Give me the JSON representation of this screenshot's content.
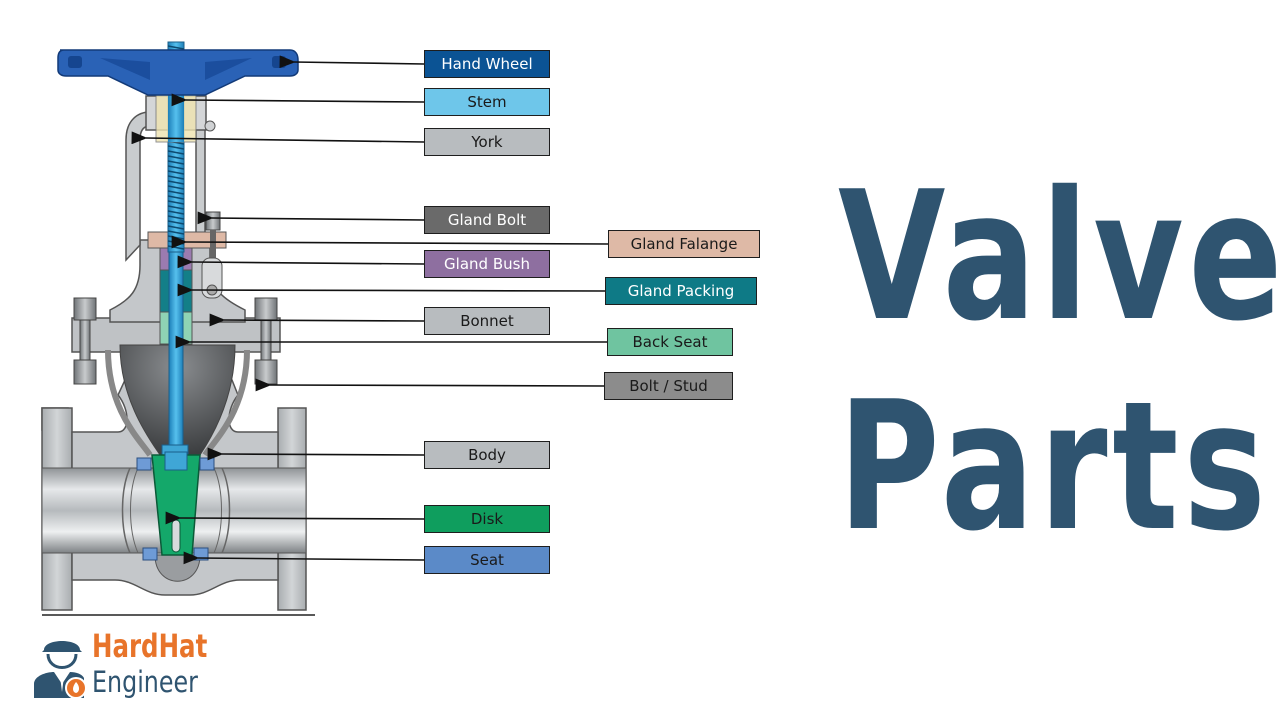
{
  "title": {
    "line1": "Valve",
    "line2": "Parts"
  },
  "logo": {
    "line1": "HardHat",
    "line2": "Engineer",
    "colors": {
      "primary": "#e8742a",
      "secondary": "#2f5470"
    }
  },
  "colors": {
    "title": "#2f5470",
    "label_border": "#1e1e1e"
  },
  "labels": [
    {
      "id": "hand-wheel",
      "text": "Hand Wheel",
      "bg": "#0b5394",
      "fg": "#ffffff"
    },
    {
      "id": "stem",
      "text": "Stem",
      "bg": "#6ec6ea",
      "fg": "#1a1a1a"
    },
    {
      "id": "york",
      "text": "York",
      "bg": "#b8bcbf",
      "fg": "#1a1a1a"
    },
    {
      "id": "gland-bolt",
      "text": "Gland Bolt",
      "bg": "#6a6a6a",
      "fg": "#ffffff"
    },
    {
      "id": "gland-falange",
      "text": "Gland Falange",
      "bg": "#deb9a6",
      "fg": "#1a1a1a"
    },
    {
      "id": "gland-bush",
      "text": "Gland Bush",
      "bg": "#8e6fa0",
      "fg": "#ffffff"
    },
    {
      "id": "gland-packing",
      "text": "Gland Packing",
      "bg": "#0e7a86",
      "fg": "#ffffff"
    },
    {
      "id": "bonnet",
      "text": "Bonnet",
      "bg": "#b8bcbf",
      "fg": "#1a1a1a"
    },
    {
      "id": "back-seat",
      "text": "Back Seat",
      "bg": "#6fc4a0",
      "fg": "#1a1a1a"
    },
    {
      "id": "bolt-stud",
      "text": "Bolt / Stud",
      "bg": "#8c8c8c",
      "fg": "#1a1a1a"
    },
    {
      "id": "body",
      "text": "Body",
      "bg": "#b8bcbf",
      "fg": "#1a1a1a"
    },
    {
      "id": "disk",
      "text": "Disk",
      "bg": "#0f9e5e",
      "fg": "#1a1a1a"
    },
    {
      "id": "seat",
      "text": "Seat",
      "bg": "#5b8ac8",
      "fg": "#1a1a1a"
    }
  ]
}
